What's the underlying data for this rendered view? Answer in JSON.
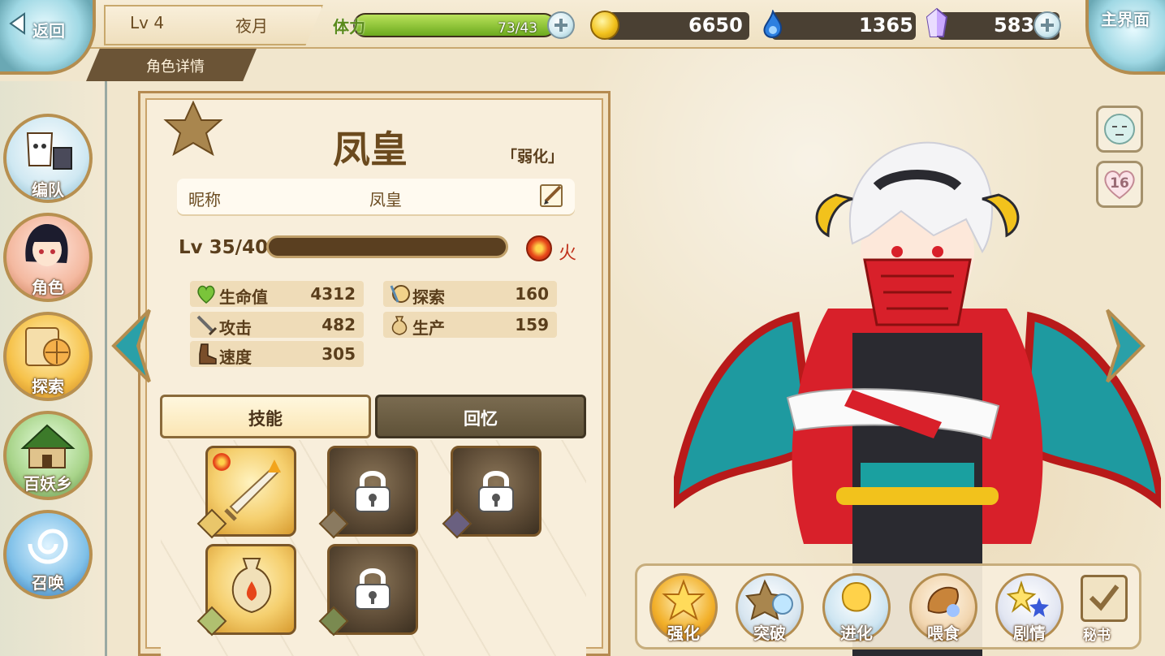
{
  "top_bar": {
    "back_label": "返回",
    "level": "Lv 4",
    "player_name": "夜月",
    "subtitle": "角色详情",
    "stamina_label": "体力",
    "stamina_value": "73/43",
    "stamina_fraction": 1.0,
    "gold": "6650",
    "spirit": "1365",
    "crystal": "583",
    "home_label": "主界面"
  },
  "left_nav": {
    "items": [
      {
        "label": "编队",
        "icon": "team-icon"
      },
      {
        "label": "角色",
        "icon": "character-icon"
      },
      {
        "label": "探索",
        "icon": "explore-icon"
      },
      {
        "label": "百妖乡",
        "icon": "village-icon"
      },
      {
        "label": "召唤",
        "icon": "summon-icon"
      }
    ]
  },
  "character": {
    "name": "凤皇",
    "tag": "「弱化」",
    "nickname_label": "昵称",
    "nickname": "凤皇",
    "level": "Lv 35/40",
    "exp_fraction": 0.0,
    "element": "火",
    "stats": {
      "hp_label": "生命值",
      "hp": "4312",
      "atk_label": "攻击",
      "atk": "482",
      "spd_label": "速度",
      "spd": "305",
      "explore_label": "探索",
      "explore": "160",
      "produce_label": "生产",
      "produce": "159"
    }
  },
  "tabs": {
    "skill": "技能",
    "memory": "回忆"
  },
  "skills": [
    {
      "type": "attack",
      "locked": false
    },
    {
      "type": "attack",
      "locked": true
    },
    {
      "type": "passive",
      "locked": true
    },
    {
      "type": "produce",
      "locked": false
    },
    {
      "type": "produce",
      "locked": true
    }
  ],
  "side": {
    "affection": "16"
  },
  "actions": {
    "enhance": "强化",
    "breakthrough": "突破",
    "evolve": "进化",
    "feed": "喂食",
    "story": "剧情",
    "secretary": "秘书"
  },
  "colors": {
    "panel_border": "#b58a50",
    "stamina_green": "#8cc63f",
    "fire": "#e6461a"
  }
}
